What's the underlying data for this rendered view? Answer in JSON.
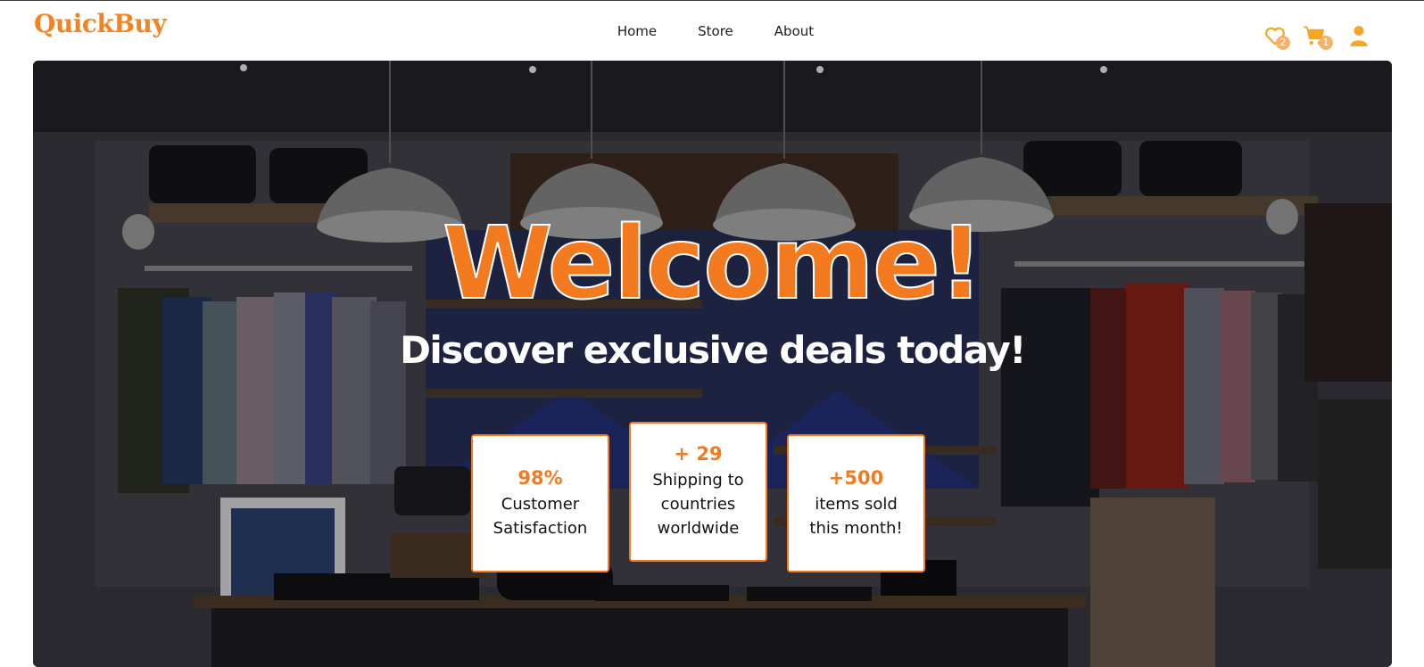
{
  "brand": {
    "logo": "QuickBuy",
    "accent": "#f58220"
  },
  "nav": {
    "items": [
      "Home",
      "Store",
      "About"
    ]
  },
  "header_icons": {
    "wishlist": {
      "icon": "heart-icon",
      "count": "2"
    },
    "cart": {
      "icon": "cart-icon",
      "count": "1"
    },
    "account": {
      "icon": "user-icon"
    }
  },
  "hero": {
    "title": "Welcome!",
    "subtitle": "Discover exclusive deals today!",
    "stats": [
      {
        "value": "98%",
        "label": "Customer\nSatisfaction"
      },
      {
        "value": "+ 29",
        "label": "Shipping to\ncountries\nworldwide"
      },
      {
        "value": "+500",
        "label": "items sold\nthis month!"
      }
    ]
  }
}
